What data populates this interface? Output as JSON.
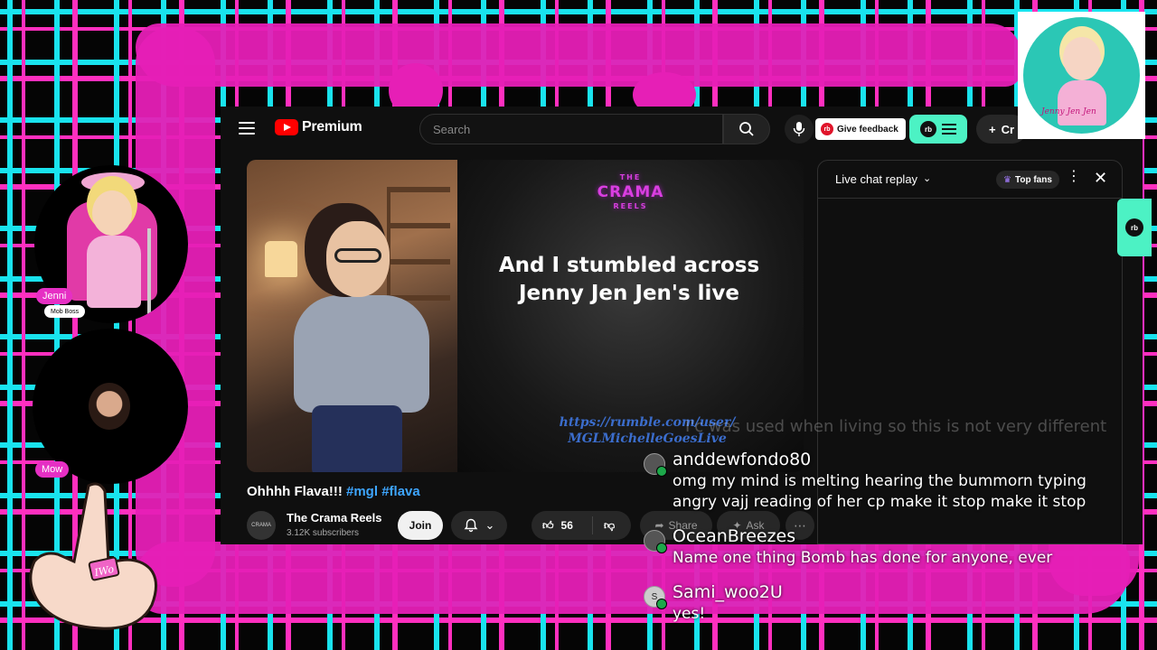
{
  "youtube": {
    "logo_text": "Premium",
    "search_placeholder": "Search",
    "feedback_label": "Give feedback",
    "rumble_badge": "rb",
    "create_label": "Cr",
    "video": {
      "channel_logo_top": "THE",
      "channel_logo": "CRAMA",
      "channel_logo_bottom": "REELS",
      "caption": "And I stumbled across Jenny Jen Jen's live",
      "url_line1": "https://rumble.com/user/",
      "url_line2": "MGLMichelleGoesLive"
    },
    "title": "Ohhhh Flava!!!",
    "hashtags": [
      "#mgl",
      "#flava"
    ],
    "channel": {
      "name": "The Crama Reels",
      "subscribers": "3.12K subscribers",
      "join_label": "Join",
      "like_count": "56",
      "share_label": "Share",
      "ask_label": "Ask"
    },
    "chat_panel": {
      "title": "Live chat replay",
      "top_fans_label": "Top fans"
    }
  },
  "overlay": {
    "faded_message": "I'c was used when living so this is not very different",
    "messages": [
      {
        "author": "anddewfondo80",
        "text": "omg my mind is melting hearing the bummorn typing angry vajj reading of her cp make it stop make it stop"
      },
      {
        "author": "OceanBreezes",
        "text": "Name one thing Bomb has done for anyone, ever"
      },
      {
        "author": "Sami_woo2U",
        "avatar_letter": "S",
        "text": "yes!"
      }
    ],
    "cams": [
      {
        "label": "Jenni",
        "sublabel": "Mob Boss"
      },
      {
        "label": "Mow"
      }
    ],
    "ring_text": "IWo",
    "logo_signature": "Jenny Jen Jen"
  },
  "colors": {
    "accent_pink": "#e61fb6",
    "accent_cyan": "#19e3ee",
    "rumble_green": "#4cf2c4",
    "youtube_red": "#ff0000",
    "link_blue": "#3ea6ff"
  }
}
